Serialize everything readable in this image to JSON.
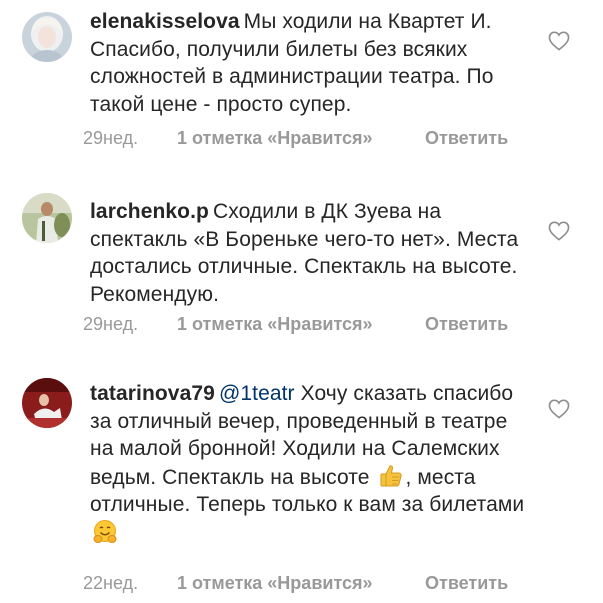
{
  "comments": [
    {
      "username": "elenakisselova",
      "text": "Мы ходили на Квартет И. Спасибо, получили билеты без всяких сложностей в администрации театра. По такой цене - просто супер.",
      "time": "29нед.",
      "likes": "1 отметка «Нравится»",
      "reply": "Ответить",
      "avatar_icon": "user-avatar-blonde"
    },
    {
      "username": "larchenko.p",
      "text": "Сходили в ДК Зуева на спектакль «В Бореньке чего-то нет». Места достались отличные. Спектакль на высоте. Рекомендую.",
      "time": "29нед.",
      "likes": "1 отметка «Нравится»",
      "reply": "Ответить",
      "avatar_icon": "user-avatar-outdoor"
    },
    {
      "username": "tatarinova79",
      "mention": "@1teatr",
      "text_a": "Хочу сказать спасибо за отличный вечер, проведенный в театре на малой бронной! Ходили на Салемских ведьм. Спектакль на высоте",
      "emoji_a": "thumbs-up-emoji",
      "text_b": ", места отличные. Теперь только к вам за билетами",
      "emoji_b": "hugging-face-emoji",
      "time": "22нед.",
      "likes": "1 отметка «Нравится»",
      "reply": "Ответить",
      "avatar_icon": "user-avatar-red-theatre"
    }
  ],
  "colors": {
    "text": "#262626",
    "meta": "#999999",
    "mention": "#003569",
    "heart": "#8e8e8e"
  },
  "icons": {
    "like": "heart-outline-icon"
  }
}
